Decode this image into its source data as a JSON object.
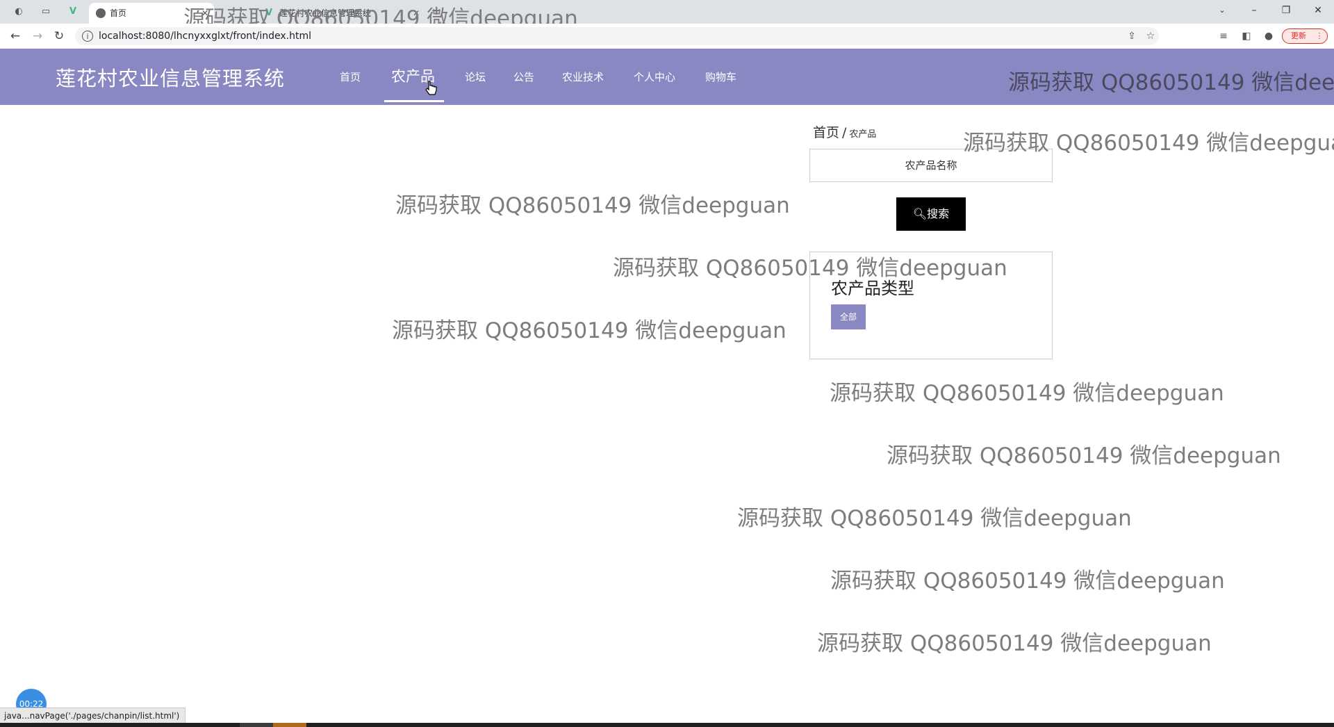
{
  "browser": {
    "tabs": [
      {
        "title": "首页"
      },
      {
        "title": "莲花村农业信息管理系统"
      }
    ],
    "url": "localhost:8080/lhcnyxxglxt/front/index.html",
    "update_label": "更新"
  },
  "site": {
    "title": "莲花村农业信息管理系统",
    "menu": [
      {
        "label": "首页"
      },
      {
        "label": "农产品"
      },
      {
        "label": "论坛"
      },
      {
        "label": "公告"
      },
      {
        "label": "农业技术"
      },
      {
        "label": "个人中心"
      },
      {
        "label": "购物车"
      }
    ],
    "active_menu": "农产品"
  },
  "breadcrumb": {
    "home": "首页",
    "separator": "/",
    "current": "农产品"
  },
  "search": {
    "placeholder": "农产品名称",
    "button_label": "搜索"
  },
  "category": {
    "title": "农产品类型",
    "chips": [
      "全部"
    ]
  },
  "watermark": "源码获取 QQ86050149 微信deepguan",
  "watermark_tab": "源码获取 QQ86050149 微信deepguan",
  "timer": "00:22",
  "status_bar_url": "java...navPage('./pages/chanpin/list.html')",
  "colors": {
    "nav_bg": "#8a88c3",
    "search_btn": "#000000",
    "chip_bg": "#8a88c3"
  }
}
